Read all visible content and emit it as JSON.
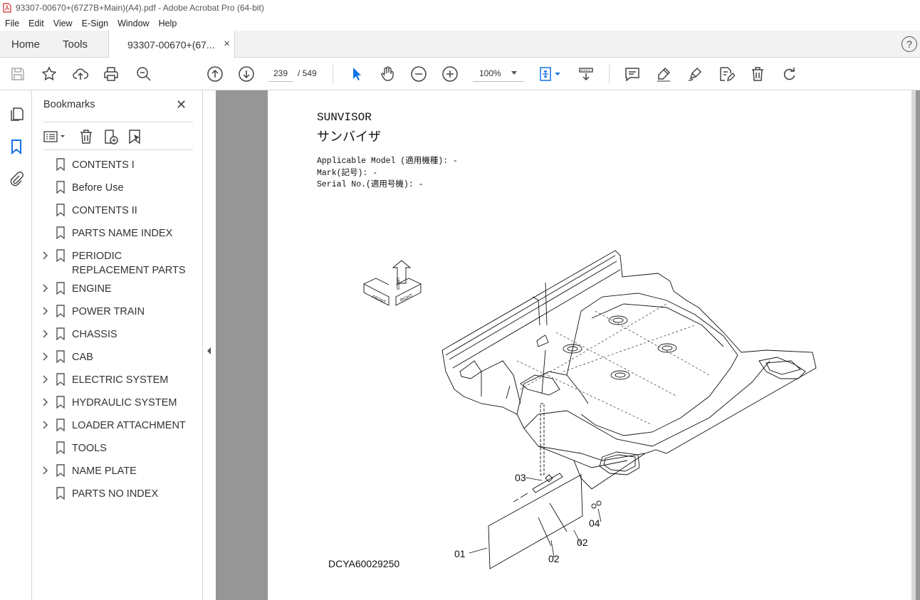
{
  "window": {
    "title": "93307-00670+(67Z7B+Main)(A4).pdf - Adobe Acrobat Pro (64-bit)"
  },
  "menu": [
    "File",
    "Edit",
    "View",
    "E-Sign",
    "Window",
    "Help"
  ],
  "tabs": {
    "home": "Home",
    "tools": "Tools",
    "document": "93307-00670+(67...",
    "close": "×"
  },
  "help_label": "?",
  "toolbar": {
    "page_current": "239",
    "page_total": "/ 549",
    "zoom": "100%"
  },
  "bookmarks": {
    "title": "Bookmarks",
    "close": "✕",
    "items": [
      {
        "label": "CONTENTS I",
        "expandable": false
      },
      {
        "label": "Before Use",
        "expandable": false
      },
      {
        "label": "CONTENTS II",
        "expandable": false
      },
      {
        "label": "PARTS NAME INDEX",
        "expandable": false
      },
      {
        "label": "PERIODIC REPLACEMENT PARTS",
        "expandable": true
      },
      {
        "label": "ENGINE",
        "expandable": true
      },
      {
        "label": "POWER TRAIN",
        "expandable": true
      },
      {
        "label": "CHASSIS",
        "expandable": true
      },
      {
        "label": "CAB",
        "expandable": true
      },
      {
        "label": "ELECTRIC SYSTEM",
        "expandable": true
      },
      {
        "label": "HYDRAULIC SYSTEM",
        "expandable": true
      },
      {
        "label": "LOADER ATTACHMENT",
        "expandable": true
      },
      {
        "label": "TOOLS",
        "expandable": false
      },
      {
        "label": "NAME PLATE",
        "expandable": true
      },
      {
        "label": "PARTS NO INDEX",
        "expandable": false
      }
    ]
  },
  "page": {
    "title": "SUNVISOR",
    "title_jp": "サンバイザ",
    "applicable_model": "Applicable Model (適用機種): -",
    "mark": "Mark(記号): -",
    "serial": "Serial No.(適用号機): -",
    "drawing_code": "DCYA60029250",
    "callouts": [
      "01",
      "02",
      "02",
      "03",
      "04"
    ],
    "compass": [
      "FRONT",
      "RIGHT",
      "UPPER"
    ]
  },
  "colors": {
    "accent_blue": "#1473e6",
    "doc_bg": "#969696"
  }
}
